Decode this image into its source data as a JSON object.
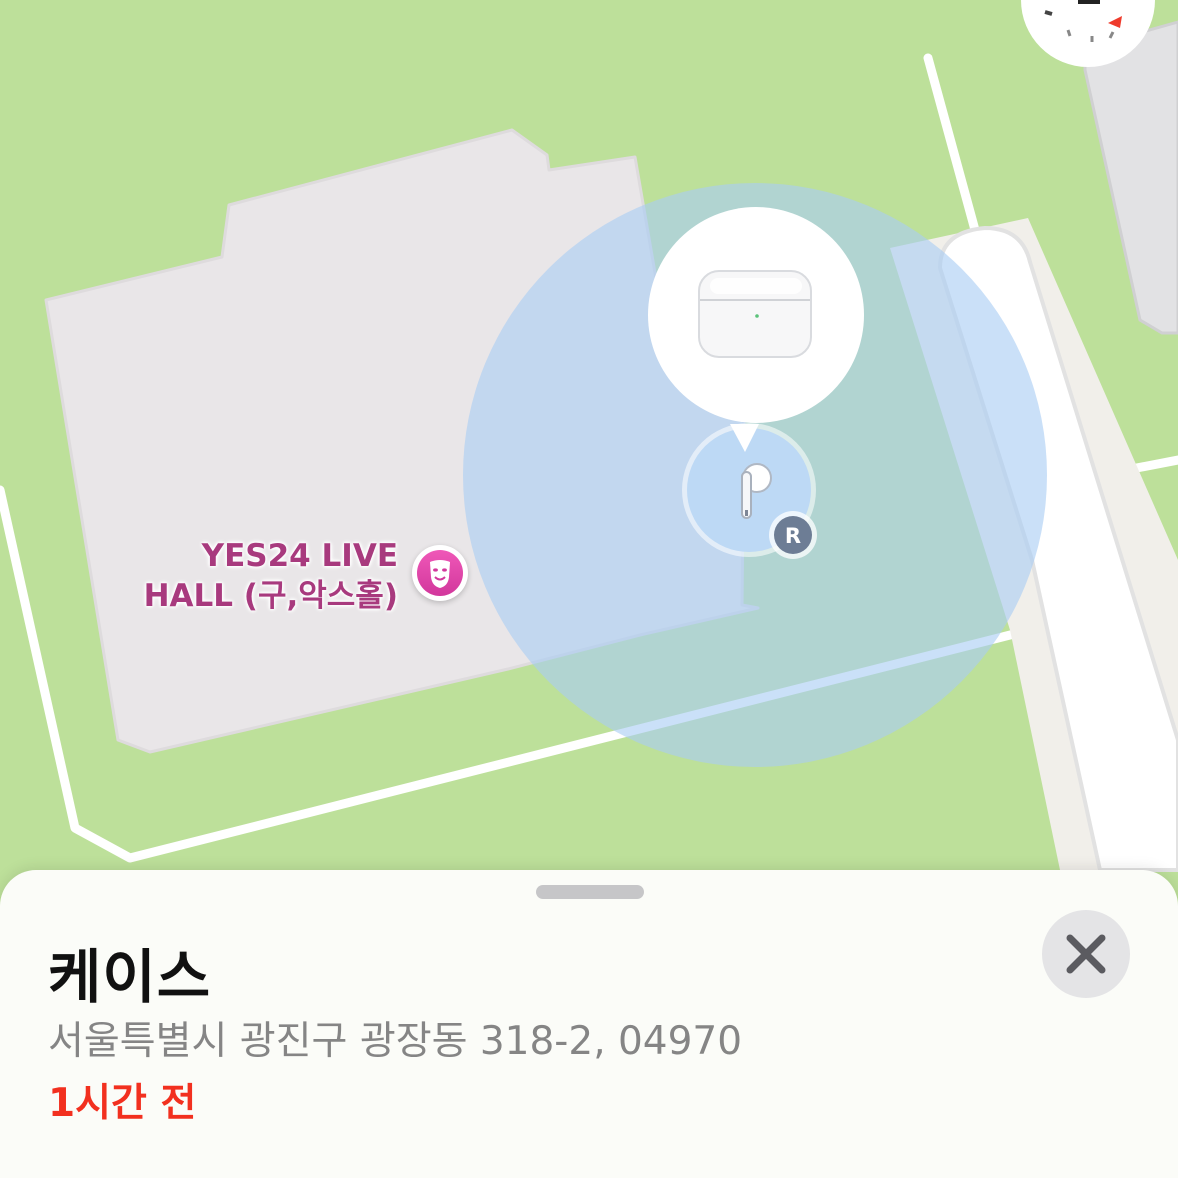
{
  "map": {
    "poi": {
      "name_line1": "YES24 LIVE",
      "name_line2": "HALL (구,악스홀)",
      "icon": "theater-masks-icon",
      "color": "#a83a7e"
    },
    "device_pin": {
      "icon": "airpods-case-icon",
      "marker_icon": "airpod-earbud-icon",
      "badge": "R"
    },
    "compass": {
      "icon": "compass-icon"
    }
  },
  "sheet": {
    "title": "케이스",
    "address": "서울특별시 광진구 광장동 318-2, 04970",
    "time": "1시간 전",
    "close_icon": "close-icon"
  },
  "colors": {
    "park": "#bde09a",
    "building": "#e8e6e7",
    "accuracy_circle": "#a9cdf4",
    "time_red": "#f2301f"
  }
}
